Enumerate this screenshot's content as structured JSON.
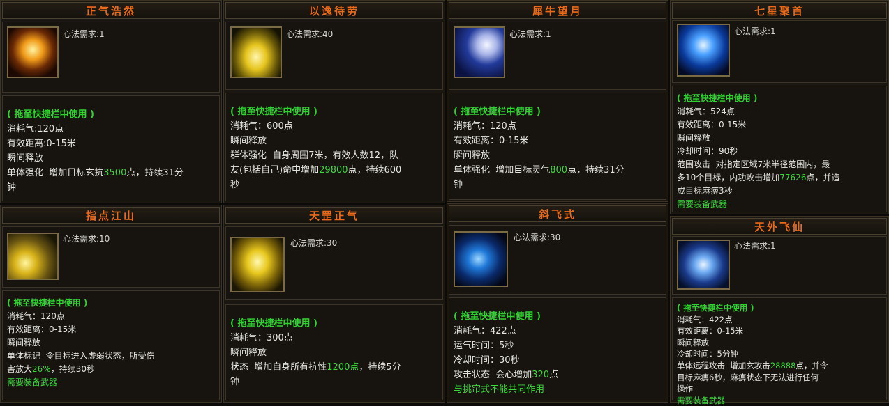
{
  "cards": {
    "c1": {
      "title": "正气浩然",
      "req": "心法需求:1",
      "drag": "( 拖至快捷栏中使用 )",
      "l1": "消耗气:120点",
      "l2": "有效距离:0-15米",
      "l3": "瞬间释放",
      "l4a": "单体强化  增加目标玄抗",
      "l4v": "3500",
      "l4b": "点，持续31分",
      "l5": "钟"
    },
    "c2": {
      "title": "以逸待劳",
      "req": "心法需求:40",
      "drag": "( 拖至快捷栏中使用 )",
      "l1": "消耗气：600点",
      "l2": "瞬间释放",
      "l3": "群体强化  自身周围7米，有效人数12，队",
      "l4a": "友(包括自己)命中增加",
      "l4v": "29800",
      "l4b": "点，持续600",
      "l5": "秒"
    },
    "c3": {
      "title": "犀牛望月",
      "req": "心法需求:1",
      "drag": "( 拖至快捷栏中使用 )",
      "l1": "消耗气：120点",
      "l2": "有效距离：0-15米",
      "l3": "瞬间释放",
      "l4a": "单体强化  增加目标灵气",
      "l4v": "800",
      "l4b": "点，持续31分",
      "l5": "钟"
    },
    "c4": {
      "title": "七星聚首",
      "req": "心法需求:1",
      "drag": "( 拖至快捷栏中使用 )",
      "l1": "消耗气：524点",
      "l2": "有效距离：0-15米",
      "l3": "瞬间释放",
      "l4": "冷却时间：90秒",
      "l5": "范围攻击  对指定区域7米半径范围内，最",
      "l6a": "多10个目标，内功攻击增加",
      "l6v": "77626",
      "l6b": "点，并造",
      "l7": "成目标麻痹3秒",
      "l8": "需要装备武器"
    },
    "c5": {
      "title": "指点江山",
      "req": "心法需求:10",
      "drag": "( 拖至快捷栏中使用 )",
      "l1": "消耗气：120点",
      "l2": "有效距离：0-15米",
      "l3": "瞬间释放",
      "l4": "单体标记  令目标进入虚弱状态，所受伤",
      "l5a": "害放大",
      "l5v": "26%",
      "l5b": "，持续30秒",
      "l6": "需要装备武器"
    },
    "c6": {
      "title": "天罡正气",
      "req": "心法需求:30",
      "drag": "( 拖至快捷栏中使用 )",
      "l1": "消耗气：300点",
      "l2": "瞬间释放",
      "l3a": "状态  增加自身所有抗性",
      "l3v": "1200点",
      "l3b": "，持续5分",
      "l4": "钟"
    },
    "c7": {
      "title": "斜飞式",
      "req": "心法需求:30",
      "drag": "( 拖至快捷栏中使用 )",
      "l1": "消耗气：422点",
      "l2": "运气时间：5秒",
      "l3": "冷却时间：30秒",
      "l4a": "攻击状态  会心增加",
      "l4v": "320",
      "l4b": "点",
      "l5": "与挑帘式不能共同作用"
    },
    "c8": {
      "title": "天外飞仙",
      "req": "心法需求:1",
      "drag": "( 拖至快捷栏中使用 )",
      "l1": "消耗气：422点",
      "l2": "有效距离：0-15米",
      "l3": "瞬间释放",
      "l4": "冷却时间：5分钟",
      "l5a": "单体远程攻击  增加玄攻击",
      "l5v": "28888",
      "l5b": "点，并令",
      "l6": "目标麻痹6秒，麻痹状态下无法进行任何",
      "l7": "操作",
      "l8": "需要装备武器"
    }
  },
  "icons": {
    "c1": "golden-figure-icon",
    "c2": "praying-figure-icon",
    "c3": "moon-face-icon",
    "c4": "star-burst-icon",
    "c5": "pointing-hand-icon",
    "c6": "glowing-body-icon",
    "c7": "blue-warrior-icon",
    "c8": "flying-swordsman-icon"
  },
  "colors": {
    "title": "#e86a1c",
    "highlight": "#3fd63f",
    "text": "#e6e6e0"
  }
}
